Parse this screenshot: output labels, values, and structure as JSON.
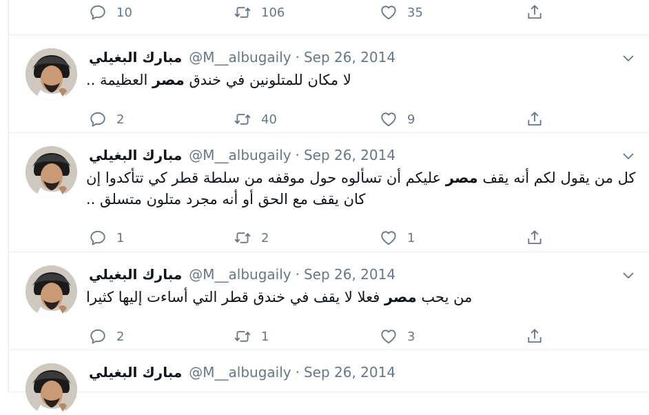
{
  "colors": {
    "text": "#0f1419",
    "muted": "#657786",
    "border": "#e6ecf0"
  },
  "icons": {
    "reply": "reply-icon",
    "retweet": "retweet-icon",
    "like": "like-icon",
    "share": "share-icon",
    "caret": "chevron-down-icon"
  },
  "top_stats": {
    "replies": "10",
    "retweets": "106",
    "likes": "35"
  },
  "tweets": [
    {
      "name": "مبارك البغيلي",
      "handle": "@M__albugaily",
      "dot": "·",
      "date": "Sep 26, 2014",
      "text_parts": [
        "لا مكان للمتلونين في خندق ",
        "مصر",
        " العظيمة .."
      ],
      "replies": "2",
      "retweets": "40",
      "likes": "9"
    },
    {
      "name": "مبارك البغيلي",
      "handle": "@M__albugaily",
      "dot": "·",
      "date": "Sep 26, 2014",
      "text_parts": [
        "كل من يقول لكم أنه يقف ",
        "مصر",
        " عليكم أن تسألوه حول موقفه من سلطة قطر كي تتأكدوا إن كان يقف مع الحق أو أنه مجرد متلون متسلق .."
      ],
      "replies": "1",
      "retweets": "2",
      "likes": "1"
    },
    {
      "name": "مبارك البغيلي",
      "handle": "@M__albugaily",
      "dot": "·",
      "date": "Sep 26, 2014",
      "text_parts": [
        "من يحب ",
        "مصر",
        " فعلا لا يقف في خندق قطر التي أساءت إليها كثيرا"
      ],
      "replies": "2",
      "retweets": "1",
      "likes": "3"
    }
  ],
  "partial": {
    "name": "مبارك البغيلي",
    "handle": "@M__albugaily",
    "dot": "·",
    "date": "Sep 26, 2014"
  }
}
